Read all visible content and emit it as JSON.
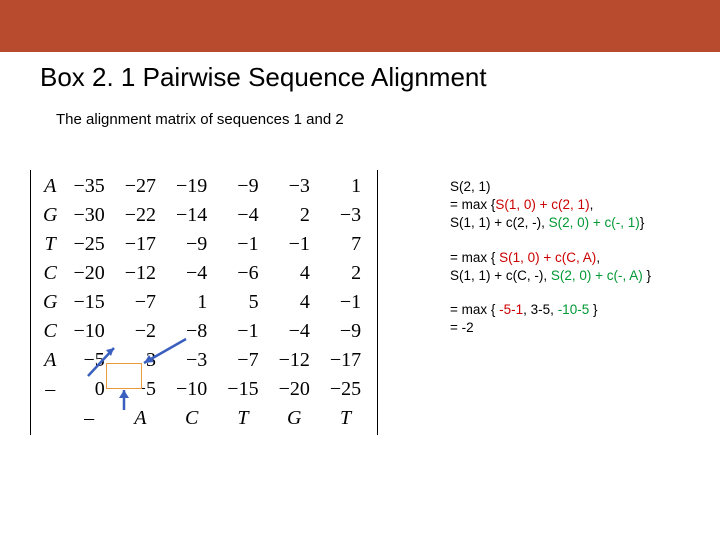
{
  "accent_bar_color": "#b84b2e",
  "title": "Box 2. 1  Pairwise Sequence Alignment",
  "subtitle": "The alignment matrix of sequences 1 and 2",
  "matrix": {
    "row_labels": [
      "A",
      "G",
      "T",
      "C",
      "G",
      "C",
      "A",
      "–"
    ],
    "col_labels": [
      "–",
      "A",
      "C",
      "T",
      "G",
      "T"
    ],
    "cells": [
      [
        "−35",
        "−27",
        "−19",
        "−9",
        "−3",
        "1"
      ],
      [
        "−30",
        "−22",
        "−14",
        "−4",
        "2",
        "−3"
      ],
      [
        "−25",
        "−17",
        "−9",
        "−1",
        "−1",
        "7"
      ],
      [
        "−20",
        "−12",
        "−4",
        "−6",
        "4",
        "2"
      ],
      [
        "−15",
        "−7",
        "1",
        "5",
        "4",
        "−1"
      ],
      [
        "−10",
        "−2",
        "−8",
        "−1",
        "−4",
        "−9"
      ],
      [
        "−5",
        "3",
        "−3",
        "−7",
        "−12",
        "−17"
      ],
      [
        "0",
        "−5",
        "−10",
        "−15",
        "−20",
        "−25"
      ]
    ]
  },
  "formulas": {
    "block1": {
      "l1": "S(2, 1)",
      "l2_pre": "=  max {",
      "l2_red": "S(1, 0) + c(2, 1)",
      "l2_post": ", ",
      "l3": "S(1, 1) + c(2, -), ",
      "l3_grn": "S(2, 0) + c(-, 1)",
      "l3_post": "}"
    },
    "block2": {
      "l1_pre": "= max { ",
      "l1_red": "S(1, 0) + c(C, A)",
      "l1_post": ",",
      "l2": "S(1, 1) + c(C, -), ",
      "l2_grn": "S(2, 0) + c(-, A)",
      "l2_post": " }"
    },
    "block3": {
      "l1_pre": "= max { ",
      "l1_red": "-5-1",
      "l1_mid": ", 3-5, ",
      "l1_grn": "-10-5",
      "l1_post": " }",
      "l2": "= -2"
    }
  }
}
